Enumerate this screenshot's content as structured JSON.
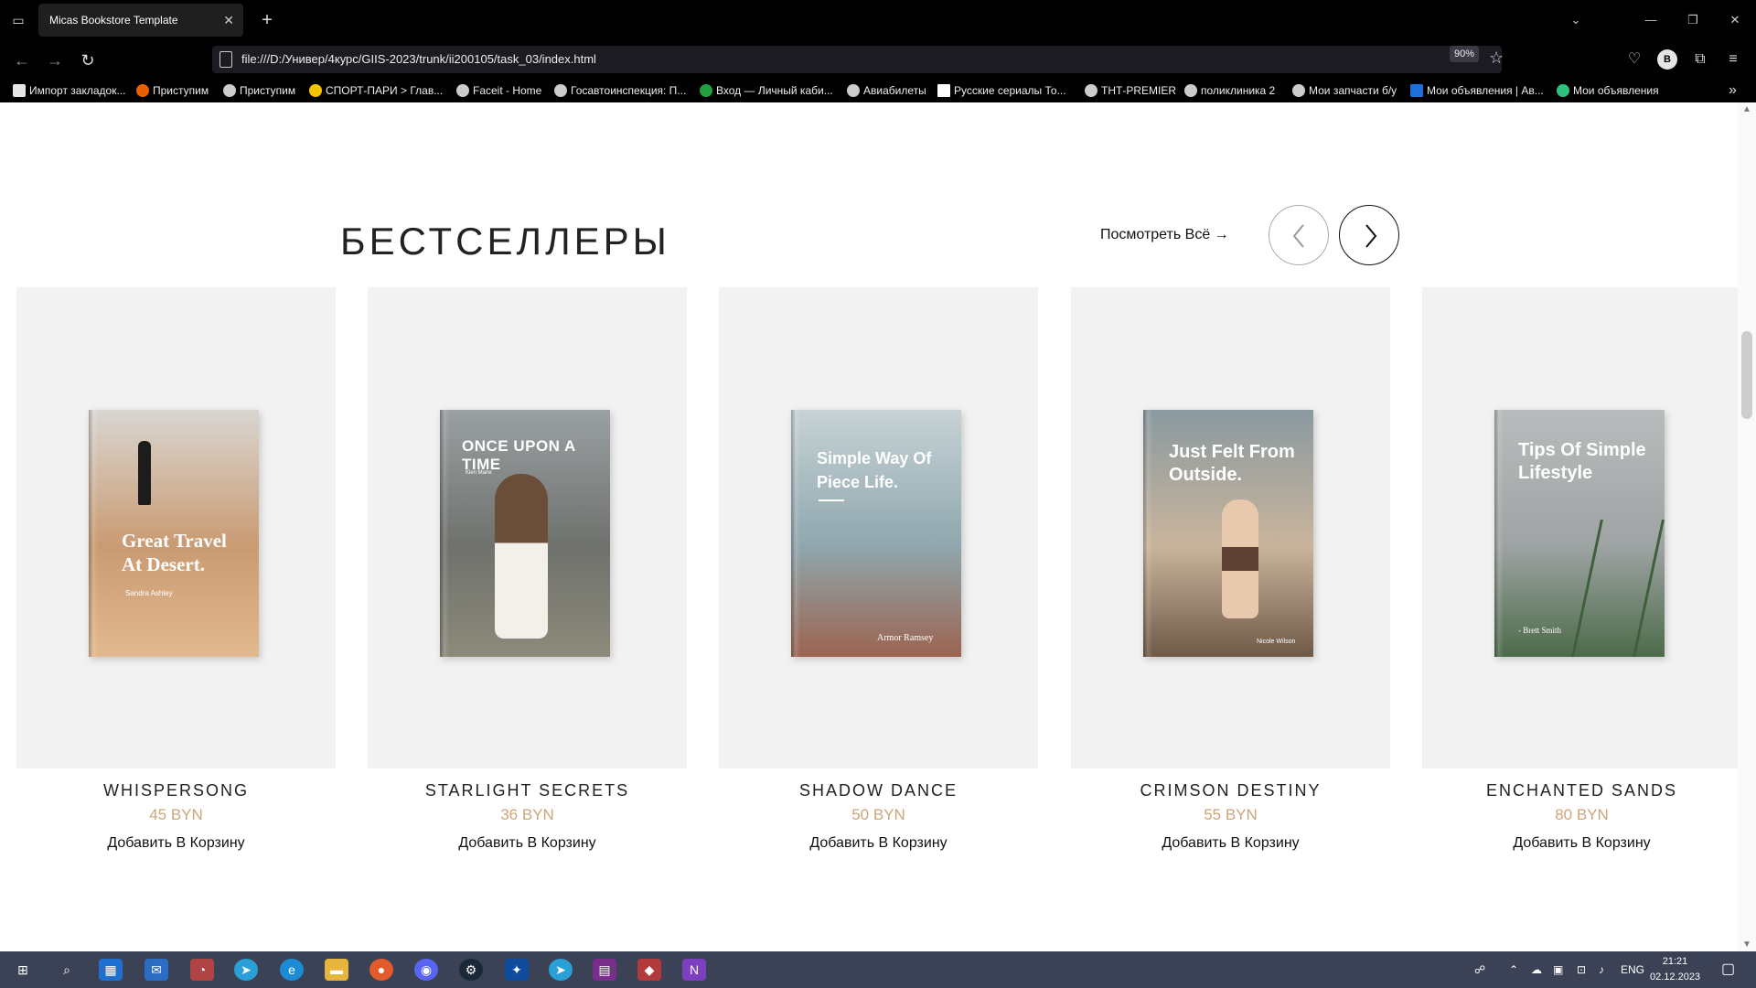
{
  "browser": {
    "tab_title": "Micas Bookstore Template",
    "url": "file:///D:/Универ/4курс/GIIS-2023/trunk/ii200105/task_03/index.html",
    "zoom": "90%",
    "profile_initial": "B",
    "bookmarks": [
      {
        "label": "Импорт закладок...",
        "icon_color": "#e6e6e6"
      },
      {
        "label": "Приступим",
        "icon_color": "#e66000"
      },
      {
        "label": "Приступим",
        "icon_color": "#cccccc"
      },
      {
        "label": "СПОРТ-ПАРИ > Глав...",
        "icon_color": "#f5c400"
      },
      {
        "label": "Faceit - Home",
        "icon_color": "#cccccc"
      },
      {
        "label": "Госавтоинспекция: П...",
        "icon_color": "#cccccc"
      },
      {
        "label": "Вход — Личный каби...",
        "icon_color": "#20a040"
      },
      {
        "label": "Авиабилеты",
        "icon_color": "#cccccc"
      },
      {
        "label": "Русские сериалы  То...",
        "icon_color": "#ffffff"
      },
      {
        "label": "ТНТ-PREMIER",
        "icon_color": "#cccccc"
      },
      {
        "label": "поликлиника 2",
        "icon_color": "#cccccc"
      },
      {
        "label": "Мои запчасти б/у",
        "icon_color": "#cccccc"
      },
      {
        "label": "Мои объявления | Ав...",
        "icon_color": "#1e6fd9"
      },
      {
        "label": "Мои объявления",
        "icon_color": "#2ec27e"
      }
    ]
  },
  "page": {
    "section_title": "БЕСТСЕЛЛЕРЫ",
    "view_all": "Посмотреть Всё →",
    "books": [
      {
        "title": "WHISPERSONG",
        "price": "45 BYN",
        "add_label": "Добавить В Корзину",
        "cover_title": "Great Travel At Desert.",
        "cover_author": "Sandra Ashley",
        "cover_colors": [
          "#d9d6d2",
          "#c99b72",
          "#e3b990"
        ]
      },
      {
        "title": "STARLIGHT SECRETS",
        "price": "36 BYN",
        "add_label": "Добавить В Корзину",
        "cover_title": "ONCE UPON A TIME",
        "cover_author": "Klen Marie",
        "cover_colors": [
          "#9aa0a3",
          "#6f716d",
          "#8c8a7a"
        ]
      },
      {
        "title": "SHADOW DANCE",
        "price": "50 BYN",
        "add_label": "Добавить В Корзину",
        "cover_title": "Simple Way Of Piece Life.",
        "cover_author": "Armor Ramsey",
        "cover_colors": [
          "#c7d3d6",
          "#8fa7ae",
          "#9b6450"
        ]
      },
      {
        "title": "CRIMSON DESTINY",
        "price": "55 BYN",
        "add_label": "Добавить В Корзину",
        "cover_title": "Just Felt From Outside.",
        "cover_author": "Nicole Wilson",
        "cover_colors": [
          "#8a9aa0",
          "#c9b49c",
          "#6f5a48"
        ]
      },
      {
        "title": "ENCHANTED SANDS",
        "price": "80 BYN",
        "add_label": "Добавить В Корзину",
        "cover_title": "Tips Of Simple Lifestyle",
        "cover_author": "- Brett Smith",
        "cover_colors": [
          "#b8bcbd",
          "#9ea3a3",
          "#4d6b4a"
        ]
      }
    ]
  },
  "taskbar": {
    "lang": "ENG",
    "time": "21:21",
    "date": "02.12.2023"
  }
}
